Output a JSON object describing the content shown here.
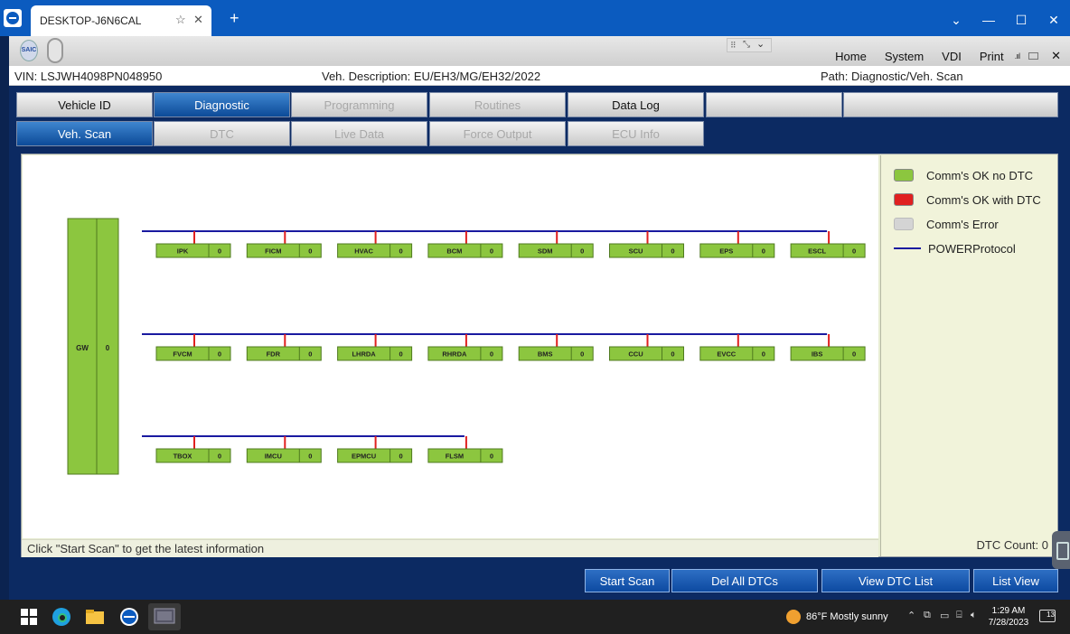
{
  "viewer": {
    "tab_title": "DESKTOP-J6N6CAL",
    "new_tab": "+",
    "controls": [
      "⌄",
      "—",
      "☐",
      "✕"
    ]
  },
  "app": {
    "menu": [
      "Home",
      "System",
      "VDI",
      "Print"
    ],
    "close": "✕",
    "signal": ".ııl"
  },
  "info": {
    "vin": "VIN:  LSJWH4098PN048950",
    "description": "Veh. Description:  EU/EH3/MG/EH32/2022",
    "path": "Path:  Diagnostic/Veh. Scan"
  },
  "main_tabs": [
    {
      "label": "Vehicle ID",
      "state": "normal"
    },
    {
      "label": "Diagnostic",
      "state": "active"
    },
    {
      "label": "Programming",
      "state": "disabled"
    },
    {
      "label": "Routines",
      "state": "disabled"
    },
    {
      "label": "Data Log",
      "state": "normal"
    },
    {
      "label": "",
      "state": "normal"
    },
    {
      "label": "",
      "state": "normal"
    }
  ],
  "sub_tabs": [
    {
      "label": "Veh. Scan",
      "state": "active"
    },
    {
      "label": "DTC",
      "state": "disabled"
    },
    {
      "label": "Live Data",
      "state": "disabled"
    },
    {
      "label": "Force Output",
      "state": "disabled"
    },
    {
      "label": "ECU Info",
      "state": "disabled"
    }
  ],
  "gateway": {
    "name": "GW",
    "dtc": "0"
  },
  "bus_rows": [
    [
      {
        "name": "IPK",
        "dtc": "0"
      },
      {
        "name": "FICM",
        "dtc": "0"
      },
      {
        "name": "HVAC",
        "dtc": "0"
      },
      {
        "name": "BCM",
        "dtc": "0"
      },
      {
        "name": "SDM",
        "dtc": "0"
      },
      {
        "name": "SCU",
        "dtc": "0"
      },
      {
        "name": "EPS",
        "dtc": "0"
      },
      {
        "name": "ESCL",
        "dtc": "0"
      }
    ],
    [
      {
        "name": "FVCM",
        "dtc": "0"
      },
      {
        "name": "FDR",
        "dtc": "0"
      },
      {
        "name": "LHRDA",
        "dtc": "0"
      },
      {
        "name": "RHRDA",
        "dtc": "0"
      },
      {
        "name": "BMS",
        "dtc": "0"
      },
      {
        "name": "CCU",
        "dtc": "0"
      },
      {
        "name": "EVCC",
        "dtc": "0"
      },
      {
        "name": "IBS",
        "dtc": "0"
      }
    ],
    [
      {
        "name": "TBOX",
        "dtc": "0"
      },
      {
        "name": "IMCU",
        "dtc": "0"
      },
      {
        "name": "EPMCU",
        "dtc": "0"
      },
      {
        "name": "FLSM",
        "dtc": "0"
      }
    ]
  ],
  "colors": {
    "ok_no_dtc": "#8cc63f",
    "ok_with_dtc": "#e02020",
    "error": "#d4d4d4",
    "protocol_line": "#1a1aa0",
    "drop_line": "#e02020"
  },
  "legend": [
    {
      "label": "Comm's OK no DTC",
      "kind": "swatch",
      "color": "#8cc63f"
    },
    {
      "label": "Comm's OK with DTC",
      "kind": "swatch",
      "color": "#e02020"
    },
    {
      "label": "Comm's Error",
      "kind": "swatch",
      "color": "#d4d4d4"
    },
    {
      "label": "POWERProtocol",
      "kind": "line",
      "color": "#1a1aa0"
    }
  ],
  "status_text": "Click \"Start Scan\" to get the latest information",
  "dtc_count": "DTC Count:  0",
  "buttons": {
    "start_scan": "Start Scan",
    "del_all": "Del All DTCs",
    "view_list": "View DTC List",
    "list_view": "List View"
  },
  "taskbar": {
    "weather": "86°F  Mostly sunny",
    "time": "1:29 AM",
    "date": "7/28/2023",
    "notifications": "13"
  }
}
